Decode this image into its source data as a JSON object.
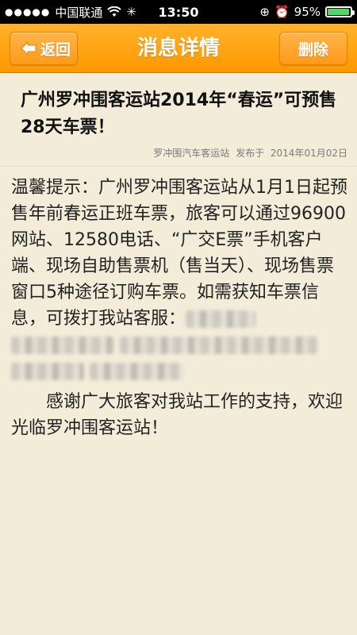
{
  "status_bar": {
    "carrier": "中国联通",
    "time": "13:50",
    "battery_text": "95%",
    "battery_level": 0.95
  },
  "nav": {
    "back_label": "返回",
    "title": "消息详情",
    "delete_label": "删除"
  },
  "article": {
    "title": "广州罗冲围客运站2014年“春运”可预售28天车票！",
    "source": "罗冲围汽车客运站",
    "published_prefix": "发布于",
    "date": "2014年01月02日",
    "body": "温馨提示：广州罗冲围客运站从1月1日起预售年前春运正班车票，旅客可以通过96900网站、12580电话、“广交E票”手机客户端、现场自助售票机（售当天）、现场售票窗口5种途径订购车票。如需获知车票信息，可拨打我站客服：",
    "thanks": "感谢广大旅客对我站工作的支持，欢迎光临罗冲围客运站！"
  },
  "colors": {
    "nav_orange": "#ff9800",
    "background": "#f3ecd9",
    "battery_green": "#4cd964"
  }
}
